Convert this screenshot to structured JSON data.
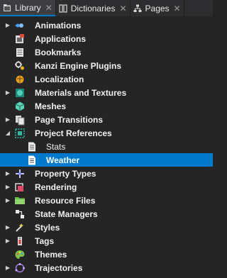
{
  "tabs": [
    {
      "label": "Library",
      "icon": "library-icon",
      "active": true
    },
    {
      "label": "Dictionaries",
      "icon": "dictionaries-icon",
      "active": false
    },
    {
      "label": "Pages",
      "icon": "pages-icon",
      "active": false
    }
  ],
  "tree": {
    "items": [
      {
        "label": "Animations",
        "icon": "animations-icon"
      },
      {
        "label": "Applications",
        "icon": "applications-icon"
      },
      {
        "label": "Bookmarks",
        "icon": "bookmarks-icon"
      },
      {
        "label": "Kanzi Engine Plugins",
        "icon": "plugins-icon"
      },
      {
        "label": "Localization",
        "icon": "localization-icon"
      },
      {
        "label": "Materials and Textures",
        "icon": "materials-icon"
      },
      {
        "label": "Meshes",
        "icon": "meshes-icon"
      },
      {
        "label": "Page Transitions",
        "icon": "page-transitions-icon"
      },
      {
        "label": "Project References",
        "icon": "project-references-icon"
      },
      {
        "label": "Stats",
        "icon": "document-icon"
      },
      {
        "label": "Weather",
        "icon": "document-icon"
      },
      {
        "label": "Property Types",
        "icon": "property-types-icon"
      },
      {
        "label": "Rendering",
        "icon": "rendering-icon"
      },
      {
        "label": "Resource Files",
        "icon": "folder-icon"
      },
      {
        "label": "State Managers",
        "icon": "state-managers-icon"
      },
      {
        "label": "Styles",
        "icon": "styles-icon"
      },
      {
        "label": "Tags",
        "icon": "tags-icon"
      },
      {
        "label": "Themes",
        "icon": "themes-icon"
      },
      {
        "label": "Trajectories",
        "icon": "trajectories-icon"
      }
    ]
  },
  "colors": {
    "background": "#252526",
    "selection": "#007acc",
    "tab_bar": "#2d2d30"
  }
}
